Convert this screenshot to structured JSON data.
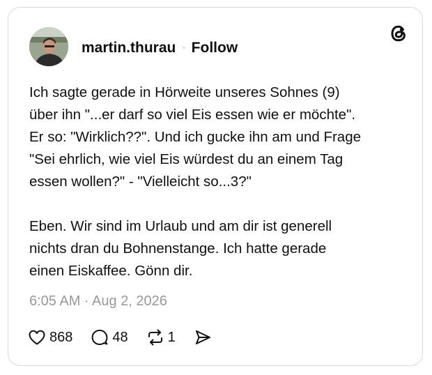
{
  "author": {
    "username": "martin.thurau",
    "separator": "·",
    "follow_label": "Follow",
    "avatar_icon": "user-avatar-photo"
  },
  "platform": {
    "logo_icon": "threads-logo-icon"
  },
  "post": {
    "paragraph_1": "Ich sagte gerade in Hörweite unseres Sohnes (9)\nüber ihn \"...er darf so viel Eis essen wie er möchte\".\nEr so: \"Wirklich??\". Und ich gucke ihn am und Frage\n\"Sei ehrlich, wie viel Eis würdest du an einem Tag\nessen wollen?\" - \"Vielleicht so...3?\"",
    "paragraph_2": "Eben. Wir sind im Urlaub und am dir ist generell\nnichts dran du Bohnenstange. Ich hatte gerade\neinen Eiskaffee. Gönn dir.",
    "timestamp": "6:05 AM · Aug 2, 2026"
  },
  "actions": {
    "like": {
      "icon": "heart-icon",
      "count": "868"
    },
    "reply": {
      "icon": "comment-icon",
      "count": "48"
    },
    "repost": {
      "icon": "repost-icon",
      "count": "1"
    },
    "share": {
      "icon": "send-icon"
    }
  }
}
